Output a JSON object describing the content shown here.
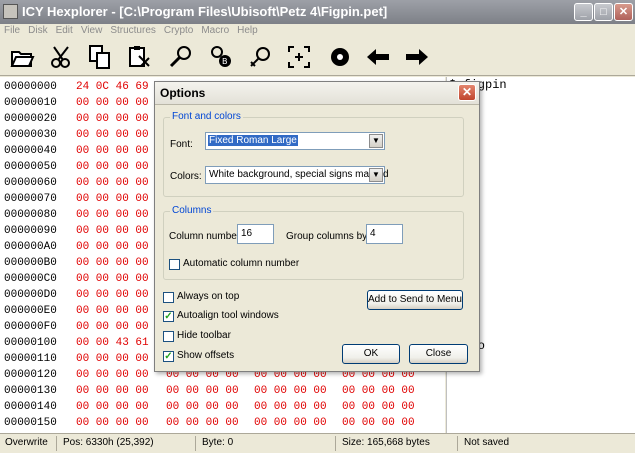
{
  "window": {
    "title": "ICY Hexplorer - [C:\\Program Files\\Ubisoft\\Petz 4\\Figpin.pet]",
    "buttons": {
      "minimize": "_",
      "maximize": "□",
      "close": "✕"
    }
  },
  "menu": [
    "File",
    "Disk",
    "Edit",
    "View",
    "Structures",
    "Crypto",
    "Macro",
    "Help"
  ],
  "toolbar": [
    "open-icon",
    "cut-icon",
    "copy-icon",
    "paste-icon",
    "search-icon",
    "replace-icon",
    "zoom-icon",
    "goto-icon",
    "record-icon",
    "back-arrow-icon",
    "forward-arrow-icon"
  ],
  "hex": {
    "rows": [
      {
        "offset": "00000000",
        "g1": "24 0C 46 69",
        "g2": "",
        "g3": "",
        "g4": ""
      },
      {
        "offset": "00000010",
        "g1": "00 00 00 00",
        "g2": "",
        "g3": "",
        "g4": ""
      },
      {
        "offset": "00000020",
        "g1": "00 00 00 00",
        "g2": "",
        "g3": "",
        "g4": ""
      },
      {
        "offset": "00000030",
        "g1": "00 00 00 00",
        "g2": "",
        "g3": "",
        "g4": ""
      },
      {
        "offset": "00000040",
        "g1": "00 00 00 00",
        "g2": "",
        "g3": "",
        "g4": ""
      },
      {
        "offset": "00000050",
        "g1": "00 00 00 00",
        "g2": "",
        "g3": "",
        "g4": ""
      },
      {
        "offset": "00000060",
        "g1": "00 00 00 00",
        "g2": "",
        "g3": "",
        "g4": ""
      },
      {
        "offset": "00000070",
        "g1": "00 00 00 00",
        "g2": "",
        "g3": "",
        "g4": ""
      },
      {
        "offset": "00000080",
        "g1": "00 00 00 00",
        "g2": "",
        "g3": "",
        "g4": ""
      },
      {
        "offset": "00000090",
        "g1": "00 00 00 00",
        "g2": "",
        "g3": "",
        "g4": ""
      },
      {
        "offset": "000000A0",
        "g1": "00 00 00 00",
        "g2": "",
        "g3": "",
        "g4": ""
      },
      {
        "offset": "000000B0",
        "g1": "00 00 00 00",
        "g2": "",
        "g3": "",
        "g4": ""
      },
      {
        "offset": "000000C0",
        "g1": "00 00 00 00",
        "g2": "",
        "g3": "",
        "g4": ""
      },
      {
        "offset": "000000D0",
        "g1": "00 00 00 00",
        "g2": "",
        "g3": "",
        "g4": ""
      },
      {
        "offset": "000000E0",
        "g1": "00 00 00 00",
        "g2": "",
        "g3": "",
        "g4": ""
      },
      {
        "offset": "000000F0",
        "g1": "00 00 00 00",
        "g2": "",
        "g3": "",
        "g4": ""
      },
      {
        "offset": "00000100",
        "g1": "00 00 43 61",
        "g2": "",
        "g3": "",
        "g4": ""
      },
      {
        "offset": "00000110",
        "g1": "00 00 00 00",
        "g2": "",
        "g3": "",
        "g4": ""
      },
      {
        "offset": "00000120",
        "g1": "00 00 00 00",
        "g2": "00 00 00 00",
        "g3": "00 00 00 00",
        "g4": "00 00 00 00"
      },
      {
        "offset": "00000130",
        "g1": "00 00 00 00",
        "g2": "00 00 00 00",
        "g3": "00 00 00 00",
        "g4": "00 00 00 00"
      },
      {
        "offset": "00000140",
        "g1": "00 00 00 00",
        "g2": "00 00 00 00",
        "g3": "00 00 00 00",
        "g4": "00 00 00 00"
      },
      {
        "offset": "00000150",
        "g1": "00 00 00 00",
        "g2": "00 00 00 00",
        "g3": "00 00 00 00",
        "g4": "00 00 00 00"
      }
    ]
  },
  "text_pane": {
    "line0": "$ figpin",
    "line16": "alico"
  },
  "status": {
    "mode": "Overwrite",
    "pos": "Pos: 6330h (25,392)",
    "byte": "Byte: 0",
    "size": "Size: 165,668 bytes",
    "saved": "Not saved"
  },
  "dialog": {
    "title": "Options",
    "font_group": {
      "legend": "Font and colors",
      "font_label": "Font:",
      "font_value": "Fixed Roman Large",
      "colors_label": "Colors:",
      "colors_value": "White background, special signs marked"
    },
    "columns_group": {
      "legend": "Columns",
      "column_number_label": "Column number:",
      "column_number_value": "16",
      "group_columns_label": "Group columns by:",
      "group_columns_value": "4",
      "auto_label": "Automatic column number"
    },
    "options": {
      "always_on_top": {
        "label": "Always on top",
        "checked": false
      },
      "autoalign": {
        "label": "Autoalign tool windows",
        "checked": true
      },
      "hide_toolbar": {
        "label": "Hide toolbar",
        "checked": false
      },
      "show_offsets": {
        "label": "Show offsets",
        "checked": true
      }
    },
    "buttons": {
      "send_to": "Add to Send to Menu",
      "ok": "OK",
      "close": "Close"
    }
  }
}
